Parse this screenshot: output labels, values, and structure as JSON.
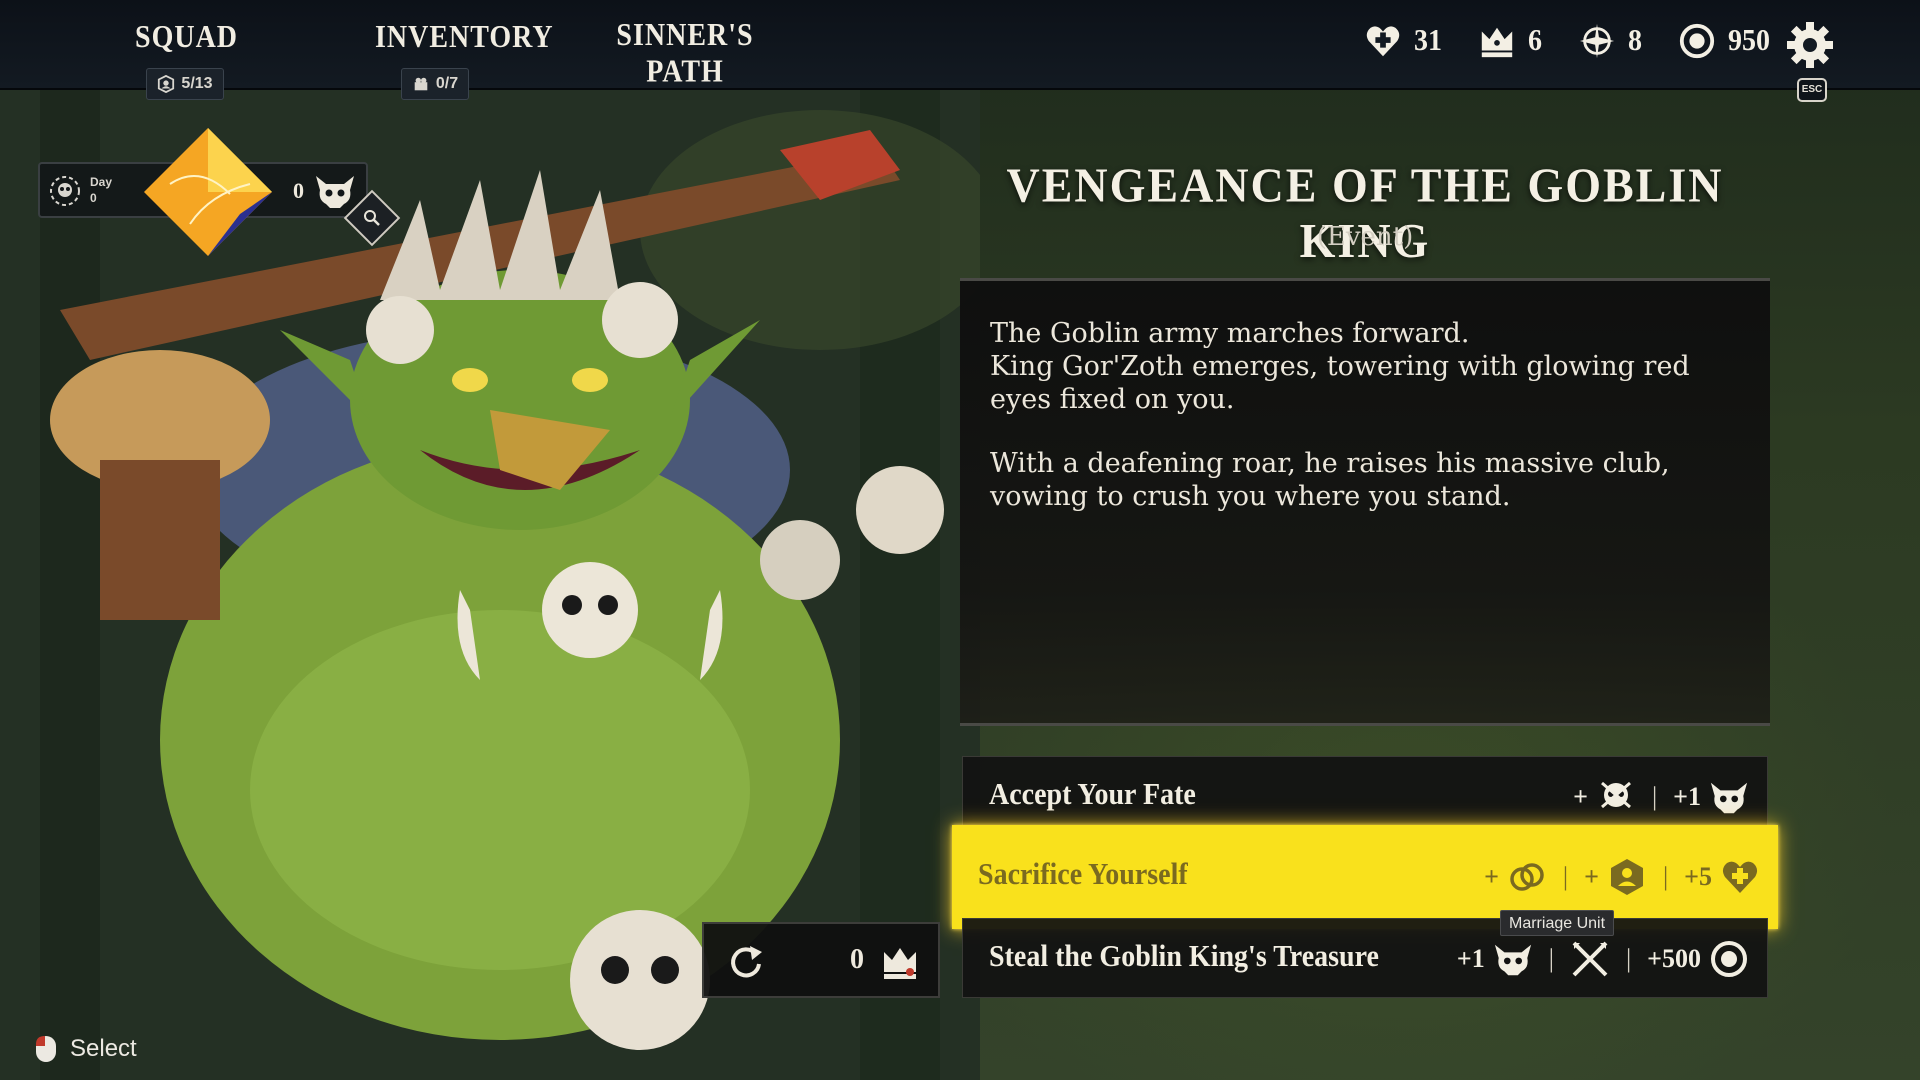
{
  "nav": {
    "tabs": [
      {
        "label": "SQUAD",
        "counter": "5/13",
        "icon": "unit-badge-icon"
      },
      {
        "label": "INVENTORY",
        "counter": "0/7",
        "icon": "inventory-icon"
      },
      {
        "label": "SINNER'S PATH"
      }
    ]
  },
  "stats": {
    "health": "31",
    "crowns": "6",
    "targets": "8",
    "gold": "950"
  },
  "settings": {
    "esc_label": "ESC"
  },
  "day": {
    "label": "Day",
    "value": "0",
    "kills": "0"
  },
  "event": {
    "title": "VENGEANCE OF THE GOBLIN KING",
    "subtitle": "(Event)",
    "paragraph1": "The Goblin army marches forward.\nKing Gor'Zoth emerges, towering with glowing red\neyes fixed on you.",
    "paragraph2": "With a deafening roar, he raises his massive club,\nvowing to crush you where you stand."
  },
  "choices": [
    {
      "label": "Accept Your Fate",
      "rewards": [
        {
          "prefix": "+",
          "icon": "skull-emblem-icon"
        },
        {
          "prefix": "+1",
          "icon": "demon-skull-icon"
        }
      ]
    },
    {
      "label": "Sacrifice Yourself",
      "selected": true,
      "rewards": [
        {
          "prefix": "+",
          "icon": "linked-rings-icon"
        },
        {
          "prefix": "+",
          "icon": "unit-hexagon-icon"
        },
        {
          "prefix": "+5",
          "icon": "heart-plus-icon"
        }
      ]
    },
    {
      "label": "Steal the Goblin King's Treasure",
      "rewards": [
        {
          "prefix": "+1",
          "icon": "demon-skull-icon"
        },
        {
          "prefix": "",
          "icon": "crossed-swords-icon"
        },
        {
          "prefix": "+500",
          "icon": "gold-coin-icon"
        }
      ]
    }
  ],
  "tooltip": "Marriage Unit",
  "reroll": {
    "count": "0"
  },
  "hint": {
    "label": "Select"
  },
  "colors": {
    "accent_yellow": "#f9e11c",
    "selected_text": "#7a6a20",
    "panel_dark": "#121212",
    "goblin_green": "#7da23a"
  }
}
